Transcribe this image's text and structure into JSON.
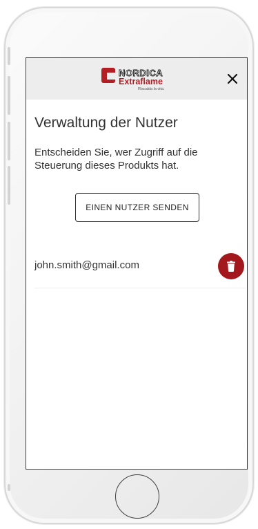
{
  "header": {
    "logo": {
      "brand_top": "NORDICA",
      "brand_bottom": "Extraflame",
      "tagline": "Riscalda la vita."
    },
    "close_icon": "close-icon"
  },
  "page": {
    "title": "Verwaltung der Nutzer",
    "description": "Entscheiden Sie, wer Zugriff auf die Steuerung dieses Produkts hat.",
    "send_button_label": "EINEN NUTZER SENDEN"
  },
  "users": [
    {
      "email": "john.smith@gmail.com",
      "action_icon": "trash-icon"
    }
  ],
  "colors": {
    "header_bg": "#ededed",
    "accent": "#a3181d",
    "text": "#333333"
  }
}
